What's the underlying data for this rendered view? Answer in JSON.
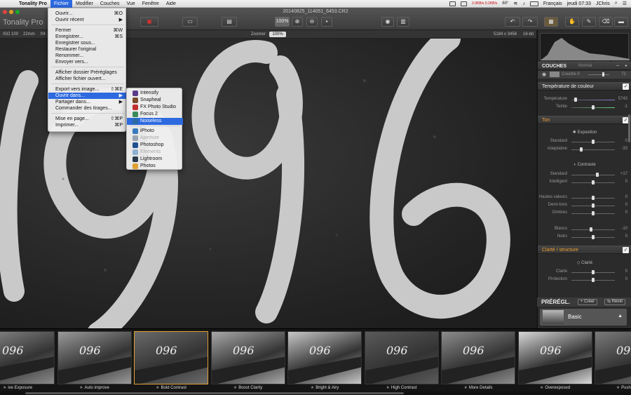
{
  "menubar": {
    "app_name": "Tonality Pro",
    "items": [
      "Fichier",
      "Modifier",
      "Couches",
      "Vue",
      "Fenêtre",
      "Aide"
    ],
    "status": {
      "network": "2.0KB/s 0.2KB/s",
      "temp": "60°",
      "language": "Français",
      "clock": "jeudi 07:33",
      "user": "JChris"
    }
  },
  "window": {
    "title": "20140825_114051_6453.CR2",
    "app_title": "Tonality Pro"
  },
  "toolbar": {
    "zoom_display": "100%"
  },
  "infobar": {
    "iso": "ISO 100",
    "focal": "22mm",
    "aperture": "f/4",
    "zoom_label": "Zoomer",
    "zoom_value": "100%",
    "dimensions": "5184 x 3456",
    "bitdepth": "16-bit"
  },
  "file_menu": {
    "items": [
      {
        "label": "Ouvrir...",
        "shortcut": "⌘O"
      },
      {
        "label": "Ouvrir récent",
        "shortcut": "▶"
      },
      {
        "label": "Fermer",
        "shortcut": "⌘W"
      },
      {
        "label": "Enregistrer...",
        "shortcut": "⌘S"
      },
      {
        "label": "Enregistrer sous...",
        "shortcut": ""
      },
      {
        "label": "Restaurer l'original",
        "shortcut": ""
      },
      {
        "label": "Renommer...",
        "shortcut": ""
      },
      {
        "label": "Envoyer vers...",
        "shortcut": ""
      },
      {
        "label": "Afficher dossier Préréglages",
        "shortcut": ""
      },
      {
        "label": "Afficher fichier ouvert...",
        "shortcut": ""
      },
      {
        "label": "Export vers image...",
        "shortcut": "⇧⌘E"
      },
      {
        "label": "Ouvrir dans...",
        "shortcut": "▶"
      },
      {
        "label": "Partager dans...",
        "shortcut": "▶"
      },
      {
        "label": "Commander des tirages...",
        "shortcut": ""
      },
      {
        "label": "Mise en page...",
        "shortcut": "⇧⌘P"
      },
      {
        "label": "Imprimer...",
        "shortcut": "⌘P"
      }
    ]
  },
  "open_in_submenu": {
    "items": [
      "Intensify",
      "Snapheal",
      "FX Photo Studio",
      "Focus 2",
      "Noiseless",
      "iPhoto",
      "Aperture",
      "Photoshop",
      "Elements",
      "Lightroom",
      "Photos"
    ],
    "icon_colors": [
      "#5a3a8a",
      "#7a4a2a",
      "#c03030",
      "#3a8a5a",
      "#2a6aa0",
      "#3a7ac0",
      "#9aa4b0",
      "#1f4f8f",
      "#8fb0d0",
      "#2a3a4a",
      "#e0a030"
    ]
  },
  "panel": {
    "layers": {
      "title": "COUCHES",
      "mode": "Normal",
      "layer_name": "Couche 0",
      "opacity": "71"
    },
    "sections": [
      {
        "title": "Température de couleur",
        "orange": false
      },
      {
        "title": "Ton",
        "orange": true
      },
      {
        "title": "Clarté / structure",
        "orange": true
      }
    ],
    "temp_rows": [
      {
        "label": "Température",
        "value": "5743",
        "pos": 0.1,
        "color": "#8a7ad0"
      },
      {
        "label": "Teinte",
        "value": "-1",
        "pos": 0.5,
        "color": "#6ad07a"
      }
    ],
    "exposition": {
      "title": "Exposition",
      "rows": [
        {
          "label": "Standard",
          "value": "0",
          "pos": 0.5
        },
        {
          "label": "Adaptative",
          "value": "-33",
          "pos": 0.22
        }
      ]
    },
    "contraste": {
      "title": "Contraste",
      "rows": [
        {
          "label": "Standard",
          "value": "+17",
          "pos": 0.6
        },
        {
          "label": "Intelligent",
          "value": "0",
          "pos": 0.5
        }
      ]
    },
    "tones": [
      {
        "label": "Hautes valeurs",
        "value": "0",
        "pos": 0.5
      },
      {
        "label": "Demi-tons",
        "value": "0",
        "pos": 0.5
      },
      {
        "label": "Ombres",
        "value": "0",
        "pos": 0.5
      }
    ],
    "levels": [
      {
        "label": "Blancs",
        "value": "-10",
        "pos": 0.45
      },
      {
        "label": "Noirs",
        "value": "0",
        "pos": 0.5
      }
    ],
    "clarte": {
      "title": "Clarté",
      "rows": [
        {
          "label": "Clarté",
          "value": "0",
          "pos": 0.5
        },
        {
          "label": "Protection",
          "value": "0",
          "pos": 0.5
        }
      ]
    }
  },
  "presets": {
    "title": "PRÉRÉGL.",
    "create": "Créer",
    "reset": "Réinit",
    "selected": "Basic"
  },
  "filmstrip": [
    {
      "label": "ive Exposure",
      "selected": false
    },
    {
      "label": "Auto improve",
      "selected": false
    },
    {
      "label": "Bold Contrast",
      "selected": true
    },
    {
      "label": "Boost Clarity",
      "selected": false
    },
    {
      "label": "Bright & Airy",
      "selected": false
    },
    {
      "label": "High Contrast",
      "selected": false
    },
    {
      "label": "More Details",
      "selected": false
    },
    {
      "label": "Overexposed",
      "selected": false
    },
    {
      "label": "Push Process",
      "selected": false
    }
  ]
}
